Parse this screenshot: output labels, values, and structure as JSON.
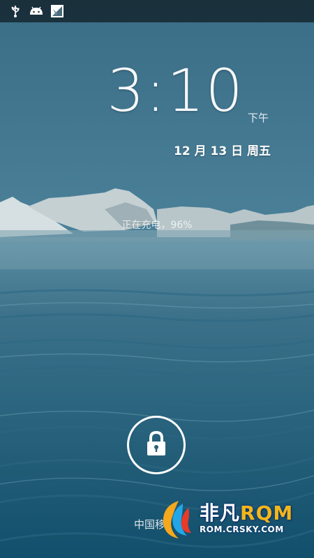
{
  "status_bar": {
    "icons": [
      "usb-icon",
      "android-debug-icon",
      "screenshot-icon"
    ]
  },
  "lockscreen": {
    "time": "3:10",
    "ampm": "下午",
    "date": "12 月 13 日 周五",
    "charging_status": "正在充电，96%",
    "carrier": "中国移",
    "lock_icon": "lock-icon"
  },
  "watermark": {
    "brand_cn": "非凡",
    "brand_en": "RQM",
    "url": "ROM.CRSKY.COM"
  },
  "colors": {
    "sea_top": "#3b7087",
    "sea_bottom": "#15546f",
    "sky": "#3e6e86"
  }
}
